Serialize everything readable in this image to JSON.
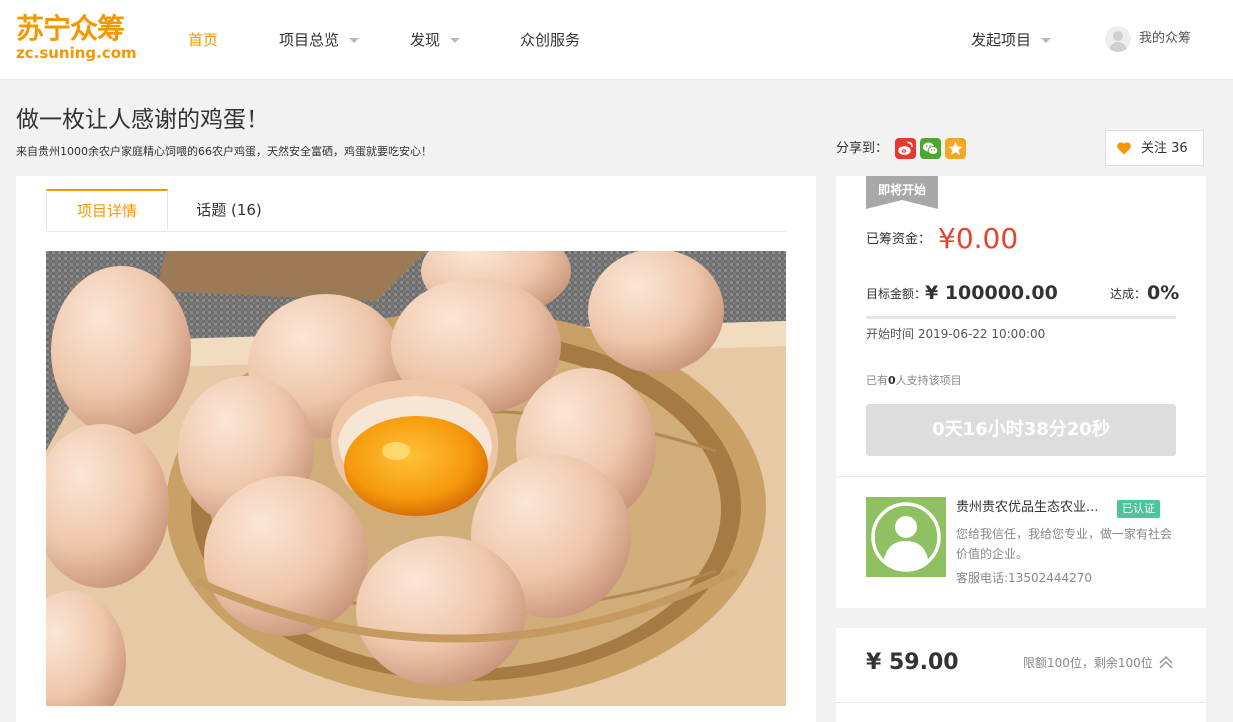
{
  "header": {
    "logo_main": "苏宁众筹",
    "logo_sub": "zc.suning.com",
    "nav": {
      "home": "首页",
      "overview": "项目总览",
      "discover": "发现",
      "services": "众创服务",
      "launch": "发起项目",
      "my": "我的众筹"
    }
  },
  "project": {
    "title": "做一枚让人感谢的鸡蛋！",
    "subtitle": "来自贵州1000余农户家庭精心饲喂的66农户鸡蛋，天然安全富硒，鸡蛋就要吃安心！",
    "share_label": "分享到：",
    "follow_label": "关注 36",
    "tabs": {
      "details": "项目详情",
      "topics": "话题 (16)"
    }
  },
  "funding": {
    "status_ribbon": "即将开始",
    "raised_label": "已筹资金：",
    "raised_value": "¥0.00",
    "goal_label": "目标金额：",
    "goal_value": "¥ 100000.00",
    "percent_label": "达成：",
    "percent_value": "0%",
    "progress_fraction": 0,
    "start_time": "开始时间 2019-06-22 10:00:00",
    "supporters_prefix": "已有",
    "supporters_count": "0",
    "supporters_suffix": "人支持该项目",
    "countdown": "0天16小时38分20秒"
  },
  "sponsor": {
    "name": "贵州贵农优品生态农业...",
    "verified": "已认证",
    "description": "您给我信任，我给您专业，做一家有社会价值的企业。",
    "phone": "客服电话:13502444270"
  },
  "reward": {
    "price": "¥ 59.00",
    "limit": "限额100位，剩余100位"
  },
  "colors": {
    "brand_orange": "#f39800",
    "price_red": "#e8432a",
    "verified_green": "#4cc59a",
    "avatar_green": "#8fc062"
  }
}
